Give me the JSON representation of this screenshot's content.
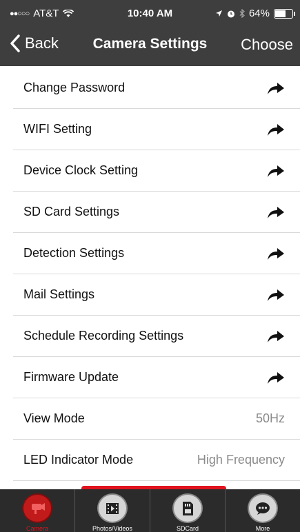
{
  "status": {
    "carrier": "AT&T",
    "time": "10:40 AM",
    "battery": "64%",
    "battery_level": 0.64
  },
  "navbar": {
    "back_label": "Back",
    "title": "Camera Settings",
    "choose_label": "Choose"
  },
  "settings": {
    "items": [
      {
        "label": "Change Password"
      },
      {
        "label": "WIFI Setting"
      },
      {
        "label": "Device Clock Setting"
      },
      {
        "label": "SD Card Settings"
      },
      {
        "label": "Detection Settings"
      },
      {
        "label": "Mail Settings"
      },
      {
        "label": "Schedule Recording Settings"
      },
      {
        "label": "Firmware Update"
      },
      {
        "label": "View Mode",
        "value": "50Hz"
      },
      {
        "label": "LED Indicator Mode",
        "value": "High Frequency"
      }
    ]
  },
  "tabs": [
    {
      "label": "Camera",
      "icon": "camera-icon",
      "active": true
    },
    {
      "label": "Photos/Videos",
      "icon": "film-icon",
      "active": false
    },
    {
      "label": "SDCard",
      "icon": "sdcard-icon",
      "active": false
    },
    {
      "label": "More",
      "icon": "chat-bubble-icon",
      "active": false
    }
  ],
  "colors": {
    "accent": "#e0141e",
    "header": "#3e3e3e",
    "tabbar": "#2b2b2b"
  }
}
